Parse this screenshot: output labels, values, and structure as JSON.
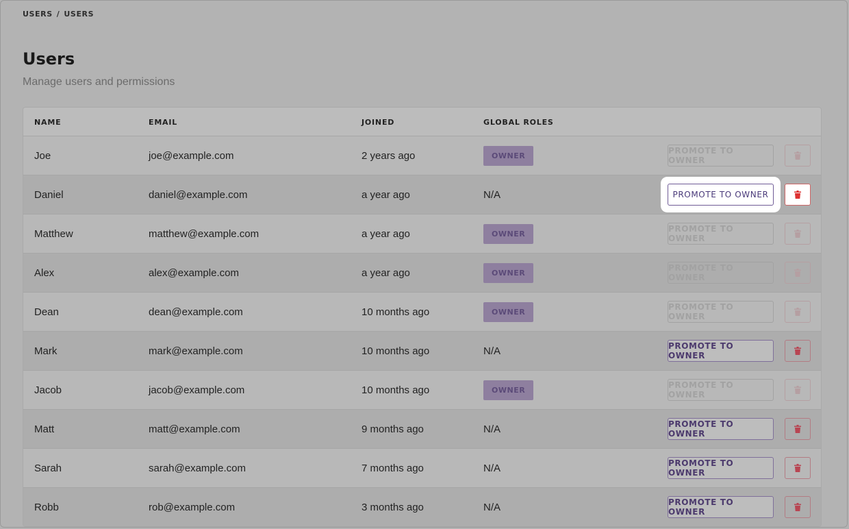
{
  "breadcrumb": {
    "parent": "USERS",
    "separator": "/",
    "current": "USERS"
  },
  "page": {
    "title": "Users",
    "subtitle": "Manage users and permissions"
  },
  "table": {
    "headers": {
      "name": "NAME",
      "email": "EMAIL",
      "joined": "JOINED",
      "roles": "GLOBAL ROLES"
    },
    "rows": [
      {
        "name": "Joe",
        "email": "joe@example.com",
        "joined": "2 years ago",
        "role": "OWNER",
        "action": "PROMOTE TO OWNER"
      },
      {
        "name": "Daniel",
        "email": "daniel@example.com",
        "joined": "a year ago",
        "role": "N/A",
        "action": "PROMOTE TO OWNER"
      },
      {
        "name": "Matthew",
        "email": "matthew@example.com",
        "joined": "a year ago",
        "role": "OWNER",
        "action": "PROMOTE TO OWNER"
      },
      {
        "name": "Alex",
        "email": "alex@example.com",
        "joined": "a year ago",
        "role": "OWNER",
        "action": "PROMOTE TO OWNER"
      },
      {
        "name": "Dean",
        "email": "dean@example.com",
        "joined": "10 months ago",
        "role": "OWNER",
        "action": "PROMOTE TO OWNER"
      },
      {
        "name": "Mark",
        "email": "mark@example.com",
        "joined": "10 months ago",
        "role": "N/A",
        "action": "PROMOTE TO OWNER"
      },
      {
        "name": "Jacob",
        "email": "jacob@example.com",
        "joined": "10 months ago",
        "role": "OWNER",
        "action": "PROMOTE TO OWNER"
      },
      {
        "name": "Matt",
        "email": "matt@example.com",
        "joined": "9 months ago",
        "role": "N/A",
        "action": "PROMOTE TO OWNER"
      },
      {
        "name": "Sarah",
        "email": "sarah@example.com",
        "joined": "7 months ago",
        "role": "N/A",
        "action": "PROMOTE TO OWNER"
      },
      {
        "name": "Robb",
        "email": "rob@example.com",
        "joined": "3 months ago",
        "role": "N/A",
        "action": "PROMOTE TO OWNER"
      }
    ]
  },
  "icons": {
    "delete": "trash-icon"
  },
  "colors": {
    "accent": "#4a3a7a",
    "danger": "#d33333",
    "overlay": "#b3b3b3"
  }
}
